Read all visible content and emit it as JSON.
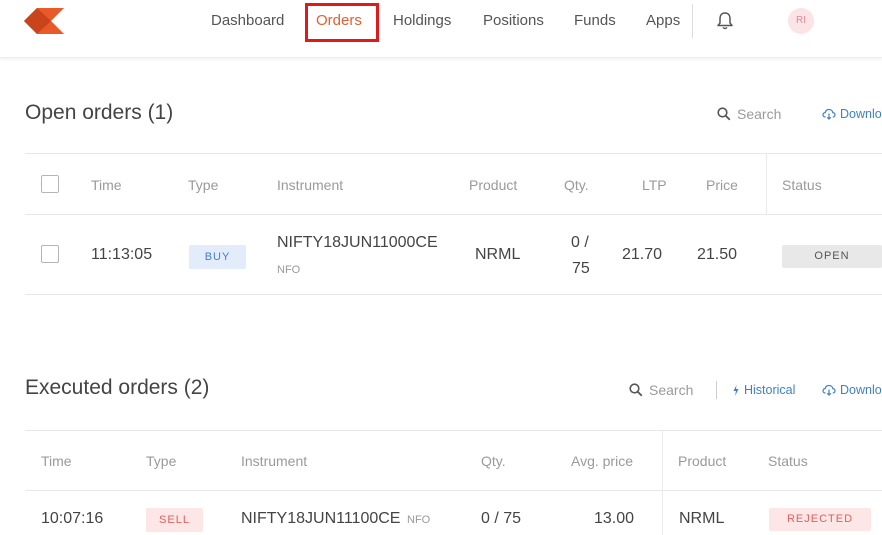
{
  "nav": {
    "items": [
      "Dashboard",
      "Orders",
      "Holdings",
      "Positions",
      "Funds",
      "Apps"
    ],
    "active": "Orders",
    "avatar_text": "RI",
    "brand_color": "#e85a2a"
  },
  "open_orders": {
    "title": "Open orders (1)",
    "search_label": "Search",
    "download_label": "Downlo",
    "columns": [
      "Time",
      "Type",
      "Instrument",
      "Product",
      "Qty.",
      "LTP",
      "Price",
      "Status"
    ],
    "rows": [
      {
        "time": "11:13:05",
        "type": "BUY",
        "instrument": "NIFTY18JUN11000CE",
        "exchange": "NFO",
        "product": "NRML",
        "qty_top": "0 /",
        "qty_bottom": "75",
        "ltp": "21.70",
        "price": "21.50",
        "status": "OPEN"
      }
    ]
  },
  "executed_orders": {
    "title": "Executed orders (2)",
    "search_label": "Search",
    "historical_label": "Historical",
    "download_label": "Downlo",
    "columns": [
      "Time",
      "Type",
      "Instrument",
      "Qty.",
      "Avg. price",
      "Product",
      "Status"
    ],
    "rows": [
      {
        "time": "10:07:16",
        "type": "SELL",
        "instrument": "NIFTY18JUN11100CE",
        "exchange": "NFO",
        "qty": "0 / 75",
        "avg_price": "13.00",
        "product": "NRML",
        "status": "REJECTED"
      }
    ]
  }
}
